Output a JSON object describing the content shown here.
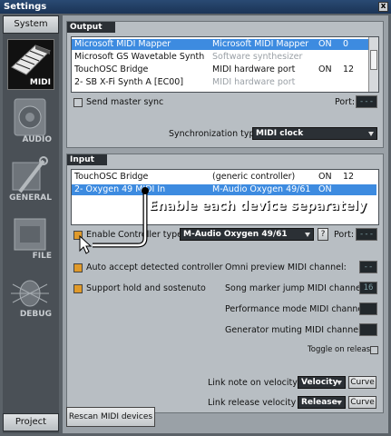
{
  "window": {
    "title": "Settings",
    "close_glyph": "x"
  },
  "sidebar": {
    "top_button": "System",
    "bottom_button": "Project",
    "tabs": [
      {
        "label": "MIDI",
        "icon": "piano-keys-icon",
        "active": true
      },
      {
        "label": "AUDIO",
        "icon": "speaker-icon",
        "active": false
      },
      {
        "label": "GENERAL",
        "icon": "tools-icon",
        "active": false
      },
      {
        "label": "FILE",
        "icon": "folder-icon",
        "active": false
      },
      {
        "label": "DEBUG",
        "icon": "bug-icon",
        "active": false
      }
    ]
  },
  "output": {
    "title": "Output",
    "rows": [
      {
        "name": "Microsoft MIDI Mapper",
        "type": "Microsoft MIDI Mapper",
        "state": "ON",
        "port": "0",
        "selected": true
      },
      {
        "name": "Microsoft GS Wavetable Synth",
        "type": "Software synthesizer",
        "state": "",
        "port": "",
        "dim": true
      },
      {
        "name": "TouchOSC Bridge",
        "type": "MIDI hardware port",
        "state": "ON",
        "port": "12"
      },
      {
        "name": "2- SB X-Fi Synth A [EC00]",
        "type": "MIDI hardware port",
        "state": "",
        "port": "",
        "dim": true
      }
    ],
    "send_master_sync": "Send master sync",
    "port_label": "Port:",
    "port_value": "---",
    "sync_label": "Synchronization type:",
    "sync_value": "MIDI clock"
  },
  "input": {
    "title": "Input",
    "rows": [
      {
        "name": "TouchOSC Bridge",
        "type": "(generic controller)",
        "state": "ON",
        "port": "12"
      },
      {
        "name": "2- Oxygen 49 MIDI In",
        "type": "M-Audio Oxygen 49/61",
        "state": "ON",
        "port": "",
        "selected": true
      }
    ],
    "enable_label": "Enable",
    "controller_type_label": "Controller type:",
    "controller_type_value": "M-Audio Oxygen 49/61",
    "help_glyph": "?",
    "port_label": "Port:",
    "port_value": "---",
    "auto_accept": "Auto accept detected controller",
    "support_hold": "Support hold and sostenuto",
    "omni_label": "Omni preview MIDI channel:",
    "omni_value": "--",
    "song_marker_label": "Song marker jump MIDI channel:",
    "song_marker_value": "16",
    "performance_label": "Performance mode MIDI channel:",
    "performance_value": "",
    "generator_label": "Generator muting MIDI channel:",
    "generator_value": "",
    "toggle_release": "Toggle on release",
    "link_note_label": "Link note on velocity to:",
    "link_note_value": "Velocity",
    "link_release_label": "Link release velocity to:",
    "link_release_value": "Release",
    "curve_label": "Curve"
  },
  "rescan_button": "Rescan MIDI devices",
  "callout": "Enable each device separately",
  "colors": {
    "accent": "#3d8be0",
    "checkbox_on": "#e09a2a",
    "panel_title": "#2b3035"
  }
}
